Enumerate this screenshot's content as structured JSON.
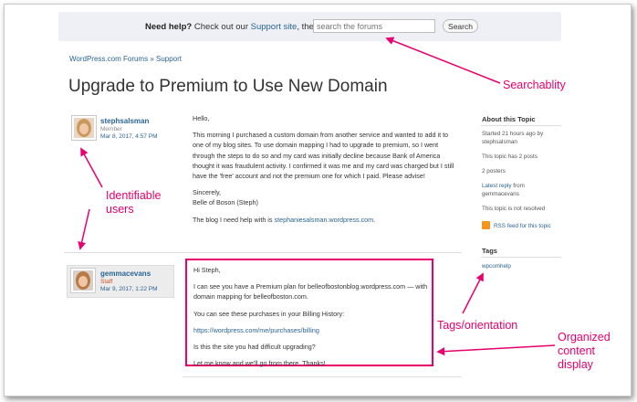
{
  "help": {
    "prefix": "Need help?",
    "middle": " Check out our ",
    "link": "Support site",
    "suffix": ", then",
    "search_placeholder": "search the forums",
    "search_button": "Search"
  },
  "breadcrumb": "WordPress.com Forums » Support",
  "title": "Upgrade to Premium to Use New Domain",
  "post1": {
    "author": "stephsalsman",
    "role": "Member",
    "date": "Mar 8, 2017, 4:57 PM",
    "paragraphs": [
      "Hello,",
      "This morning I purchased a custom domain from another service and wanted to add it to one of my blog sites. To use domain mapping I had to upgrade to premium, so I went through the steps to do so and my card was initially decline because Bank of America thought it was fraudulent activity. I confirmed it was me and my card was charged but I still have the 'free' account and not the premium one for which I paid. Please advise!",
      "Sincerely,\nBelle of Boson (Steph)"
    ],
    "blog_prefix": "The blog I need help with is ",
    "blog_link": "stephaniesalsman.wordpress.com",
    "blog_suffix": "."
  },
  "post2": {
    "author": "gemmacevans",
    "role": "Staff",
    "date": "Mar 9, 2017, 1:22 PM",
    "greeting": "Hi Steph,",
    "para1": "I can see you have a Premium plan for belleofbostonblog.wordpress.com — with domain mapping for belleofboston.com.",
    "para2": "You can see these purchases in your Billing History:",
    "billing_link": "https://wordpress.com/me/purchases/billing",
    "para3": "Is this the site you had difficult upgrading?",
    "para4": "Let me know and we'll go from there. Thanks!"
  },
  "sidebar": {
    "about_title": "About this Topic",
    "started": "Started 21 hours ago by stephsalsman",
    "posts": "This topic has 2 posts",
    "posters": "2 posters",
    "latest_prefix": "Latest reply",
    "latest_suffix": " from gemmacevans",
    "resolved": "This topic is not resolved",
    "rss": "RSS feed for this topic",
    "tags_title": "Tags",
    "tag": "wpcomhelp"
  },
  "annotations": {
    "searchability": "Searchablity",
    "users": "Identifiable\nusers",
    "tags": "Tags/orientation",
    "content": "Organized\ncontent\ndisplay"
  },
  "colors": {
    "accent": "#e8006e",
    "link": "#2a6496",
    "staff": "#d54e21",
    "rss": "#f7941d"
  }
}
